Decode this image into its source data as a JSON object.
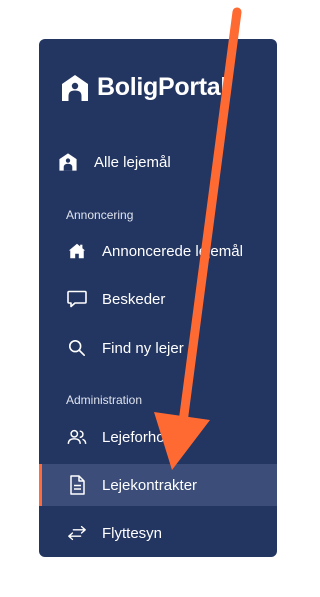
{
  "brand": {
    "name": "BoligPortal"
  },
  "nav": {
    "all_rentals": "Alle lejemål",
    "sections": [
      {
        "title": "Annoncering",
        "items": [
          {
            "label": "Annoncerede lejemål",
            "icon": "house-icon"
          },
          {
            "label": "Beskeder",
            "icon": "chat-bubble-icon"
          },
          {
            "label": "Find ny lejer",
            "icon": "search-icon"
          }
        ]
      },
      {
        "title": "Administration",
        "items": [
          {
            "label": "Lejeforhold",
            "icon": "users-icon"
          },
          {
            "label": "Lejekontrakter",
            "icon": "document-icon",
            "active": true
          },
          {
            "label": "Flyttesyn",
            "icon": "swap-arrows-icon"
          }
        ]
      }
    ]
  },
  "colors": {
    "sidebar_bg": "#233561",
    "active_bg": "#3b4d78",
    "active_accent": "#ff6b3d",
    "annotation_arrow": "#ff6a33"
  }
}
